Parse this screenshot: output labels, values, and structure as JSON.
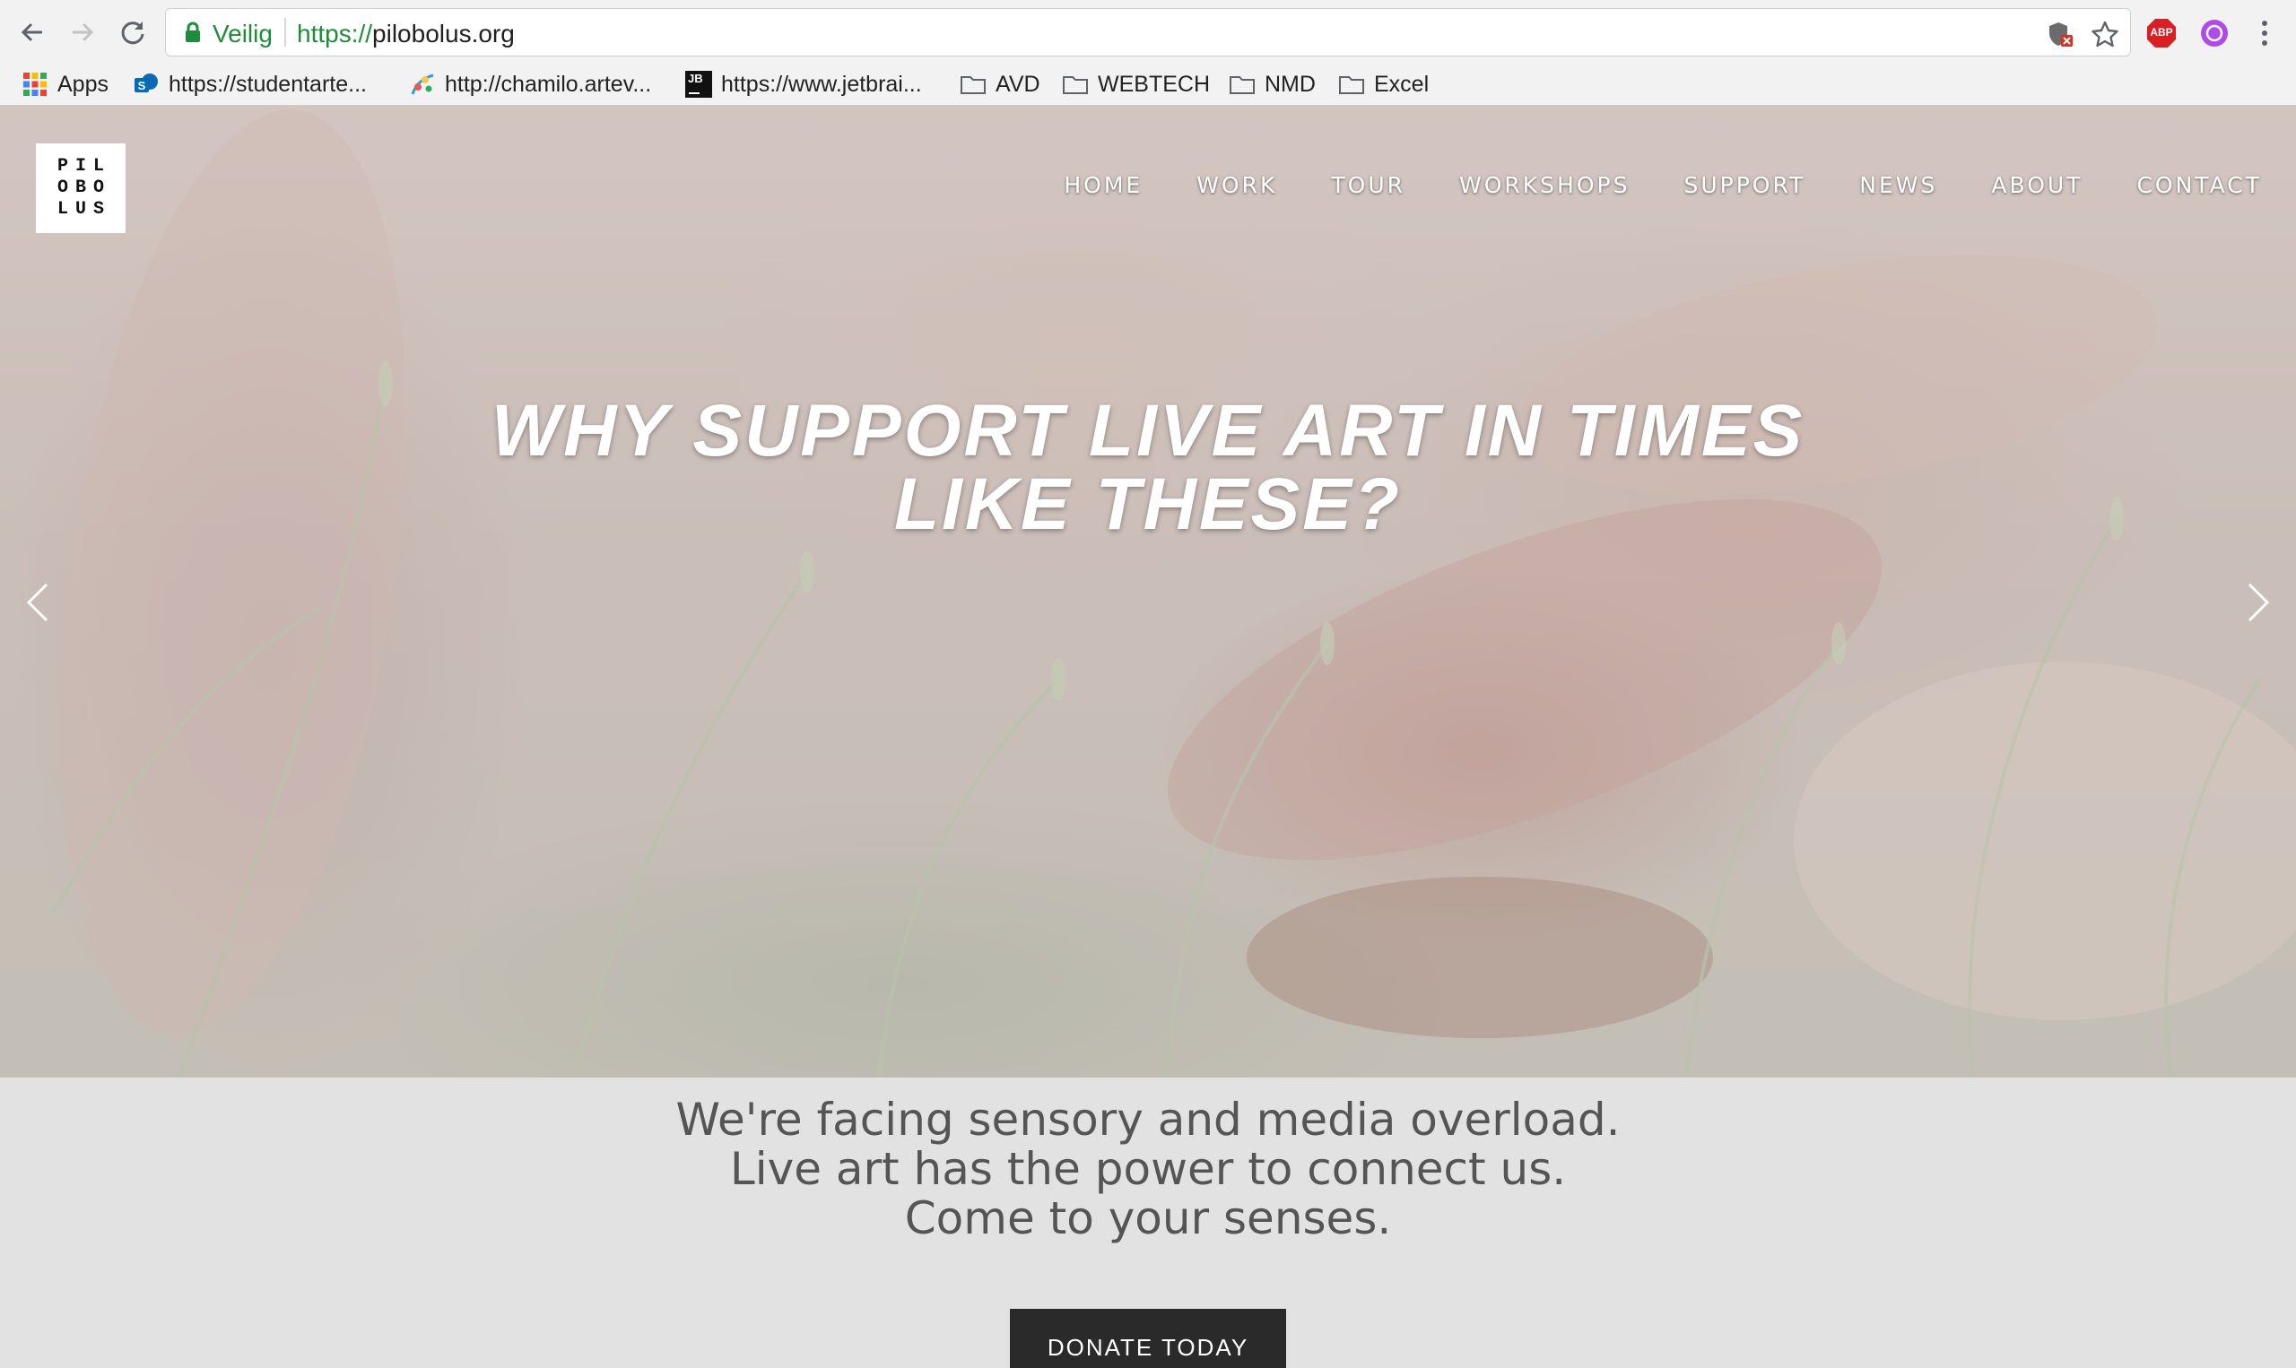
{
  "browser": {
    "secure_label": "Veilig",
    "url_scheme": "https://",
    "url_host": "pilobolus.org",
    "icons": {
      "back": "back-arrow-icon",
      "forward": "forward-arrow-icon",
      "reload": "reload-icon",
      "lock": "lock-icon",
      "site_shield": "shield-icon",
      "bookmark_star": "star-icon",
      "adblock": "adblock-plus-icon",
      "extension": "extension-icon",
      "menu": "kebab-menu-icon"
    },
    "adblock_label": "ABP",
    "bookmarks": [
      {
        "label": "Apps",
        "icon": "apps-grid-icon"
      },
      {
        "label": "https://studentarte...",
        "icon": "sharepoint-icon"
      },
      {
        "label": "http://chamilo.artev...",
        "icon": "chamilo-icon"
      },
      {
        "label": "https://www.jetbrai...",
        "icon": "jetbrains-icon"
      },
      {
        "label": "AVD",
        "icon": "folder-icon"
      },
      {
        "label": "WEBTECH",
        "icon": "folder-icon"
      },
      {
        "label": "NMD",
        "icon": "folder-icon"
      },
      {
        "label": "Excel",
        "icon": "folder-icon"
      }
    ],
    "jetbrains_badge": "JB"
  },
  "site": {
    "logo_rows": [
      "PIL",
      "OBO",
      "LUS"
    ],
    "nav": [
      "HOME",
      "WORK",
      "TOUR",
      "WORKSHOPS",
      "SUPPORT",
      "NEWS",
      "ABOUT",
      "CONTACT"
    ],
    "hero": {
      "headline_lines": [
        "WHY SUPPORT LIVE ART IN TIMES",
        "LIKE THESE?"
      ],
      "prev_icon": "chevron-left-icon",
      "next_icon": "chevron-right-icon"
    },
    "tagline_lines": [
      "We're facing sensory and media overload.",
      "Live art has the power to connect us.",
      "Come to your senses."
    ],
    "donate_label": "DONATE TODAY"
  },
  "colors": {
    "secure_green": "#1e8c3a",
    "band_bg": "#e2e2e2",
    "button_bg": "#2a2a2a",
    "tagline_text": "#555555"
  }
}
